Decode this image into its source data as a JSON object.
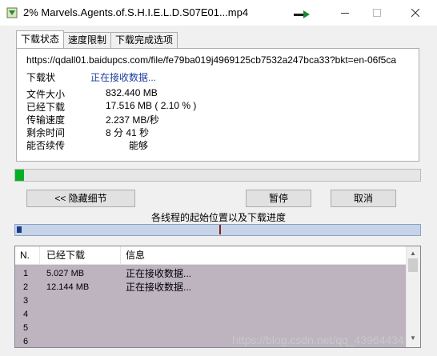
{
  "window": {
    "title": "2% Marvels.Agents.of.S.H.I.E.L.D.S07E01...mp4"
  },
  "tabs": [
    {
      "label": "下载状态"
    },
    {
      "label": "速度限制"
    },
    {
      "label": "下载完成选项"
    }
  ],
  "status": {
    "url": "https://qdall01.baidupcs.com/file/fe79ba019j4969125cb7532a247bca33?bkt=en-06f5ca",
    "state_label": "下载状",
    "state_value": "正在接收数据...",
    "file_size_label": "文件大小",
    "file_size_value": "832.440  MB",
    "downloaded_label": "已经下载",
    "downloaded_value": "17.516  MB  ( 2.10 % )",
    "speed_label": "传输速度",
    "speed_value": "2.237  MB/秒",
    "remaining_label": "剩余时间",
    "remaining_value": "8 分 41 秒",
    "resume_label": "能否续传",
    "resume_value": "能够"
  },
  "progress": {
    "fraction": 0.021,
    "color": "#06b025"
  },
  "buttons": {
    "hide_details": "<< 隐藏细节",
    "pause": "暂停",
    "cancel": "取消"
  },
  "threads": {
    "caption": "各线程的起始位置以及下载进度",
    "columns": [
      "N.",
      "已经下载",
      "信息"
    ],
    "rows": [
      {
        "n": "1",
        "downloaded": "5.027 MB",
        "info": "正在接收数据..."
      },
      {
        "n": "2",
        "downloaded": "12.144 MB",
        "info": "正在接收数据..."
      },
      {
        "n": "3",
        "downloaded": "",
        "info": ""
      },
      {
        "n": "4",
        "downloaded": "",
        "info": ""
      },
      {
        "n": "5",
        "downloaded": "",
        "info": ""
      },
      {
        "n": "6",
        "downloaded": "",
        "info": ""
      }
    ]
  },
  "watermark": "https://blog.csdn.net/qq_43964434"
}
